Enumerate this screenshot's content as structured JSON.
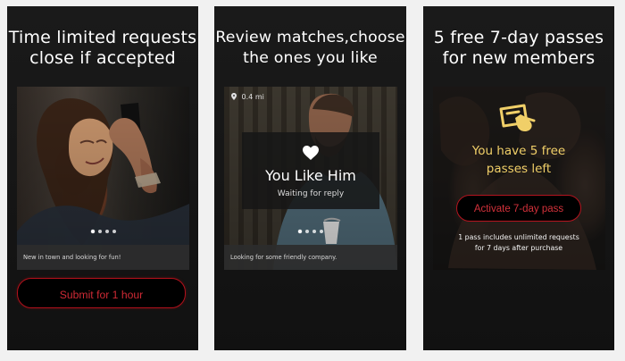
{
  "screens": [
    {
      "headline": "Time limited requests\nclose if accepted",
      "profile_caption": "New in town and looking for fun!",
      "submit_button_label": "Submit for 1 hour"
    },
    {
      "headline": "Review matches,choose\nthe ones you like",
      "distance": "0.4 mi",
      "match_title": "You Like Him",
      "match_status": "Waiting for reply",
      "profile_caption": "Looking for some friendly company."
    },
    {
      "headline": "5 free 7-day passes\nfor new members",
      "pass_message": "You have 5 free\npasses left",
      "activate_button_label": "Activate 7-day pass",
      "pass_note": "1 pass includes unlimited requests\nfor 7 days after purchase"
    }
  ],
  "icons": {
    "location": "map-pin-icon",
    "like": "heart-icon",
    "pass": "pass-ticket-icon"
  },
  "colors": {
    "background": "#f1f1f1",
    "panel": "#151515",
    "accent_red": "#b1111c",
    "highlight_gold": "#f0cf68"
  }
}
